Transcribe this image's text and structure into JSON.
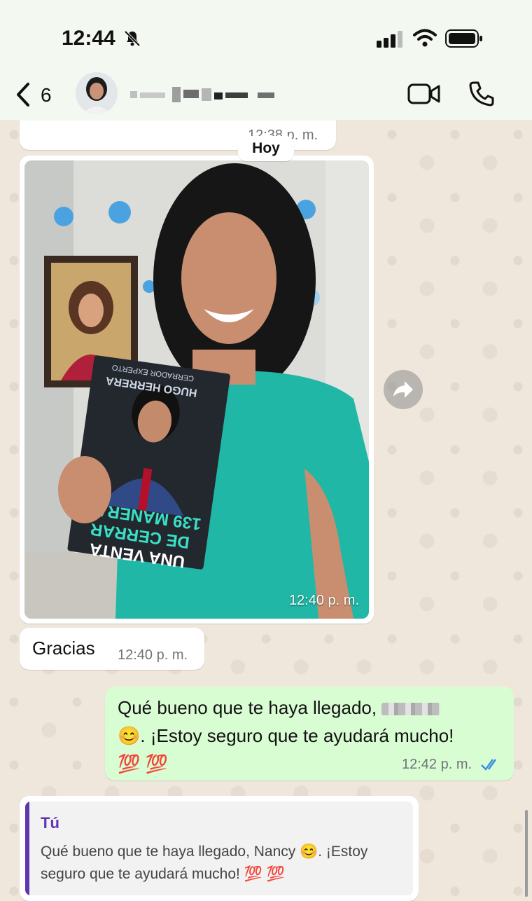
{
  "status": {
    "time": "12:44"
  },
  "header": {
    "unread_count": "6",
    "contact_name": ""
  },
  "chat": {
    "previous_time": "12:38 p. m.",
    "date_chip": "Hoy",
    "photo": {
      "time": "12:40 p. m.",
      "book": {
        "subtitle": "CERRADOR EXPERTO",
        "author": "HUGO HERRERA",
        "title_line1": "139 MANERAS",
        "title_line2": "DE CERRAR",
        "title_line3": "UNA VENTA"
      }
    },
    "incoming_text": "Gracias",
    "incoming_time": "12:40 p. m.",
    "outgoing_text_before": "Qué bueno que te haya llegado,",
    "outgoing_text_after": "😊. ¡Estoy seguro que te ayudará mucho!",
    "outgoing_emoji": "💯 💯",
    "outgoing_time": "12:42 p. m.",
    "quote": {
      "author": "Tú",
      "text": "Qué bueno que te haya llegado, Nancy 😊. ¡Estoy seguro que te ayudará mucho! 💯 💯"
    }
  },
  "colors": {
    "outgoing_bubble": "#d9fdd3",
    "quote_accent": "#5e35b1",
    "read_ticks": "#3a8fe0"
  }
}
